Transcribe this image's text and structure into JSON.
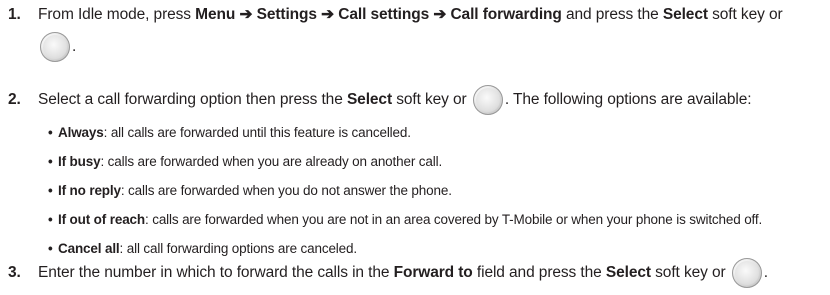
{
  "steps": [
    {
      "number": "1.",
      "text_before": "From Idle mode, press ",
      "path": [
        "Menu",
        "Settings",
        "Call settings",
        "Call forwarding"
      ],
      "arrow": "➔",
      "text_middle": " and press the ",
      "key_name": "Select",
      "text_after": " soft key or",
      "trailing": ".",
      "icon": "navigation-key-icon"
    },
    {
      "number": "2.",
      "text_before": "Select a call forwarding option then press the ",
      "key_name": "Select",
      "text_middle": " soft key or ",
      "text_after": ". The following options are available:",
      "icon": "navigation-key-icon",
      "options": [
        {
          "term": "Always",
          "desc": ": all calls are forwarded until this feature is cancelled."
        },
        {
          "term": "If busy",
          "desc": ": calls are forwarded when you are already on another call."
        },
        {
          "term": "If no reply",
          "desc": ": calls are forwarded when you do not answer the phone."
        },
        {
          "term": "If out of reach",
          "desc": ": calls are forwarded when you are not in an area covered by T-Mobile or when your phone is switched off."
        },
        {
          "term": "Cancel all",
          "desc": ": all call forwarding options are canceled."
        }
      ]
    },
    {
      "number": "3.",
      "text_before": "Enter the number in which to forward the calls in the ",
      "field_name": "Forward to",
      "text_middle": " field and press the ",
      "key_name": "Select",
      "text_after": " soft key or ",
      "trailing": ".",
      "icon": "navigation-key-icon"
    }
  ],
  "bullet_char": "•"
}
